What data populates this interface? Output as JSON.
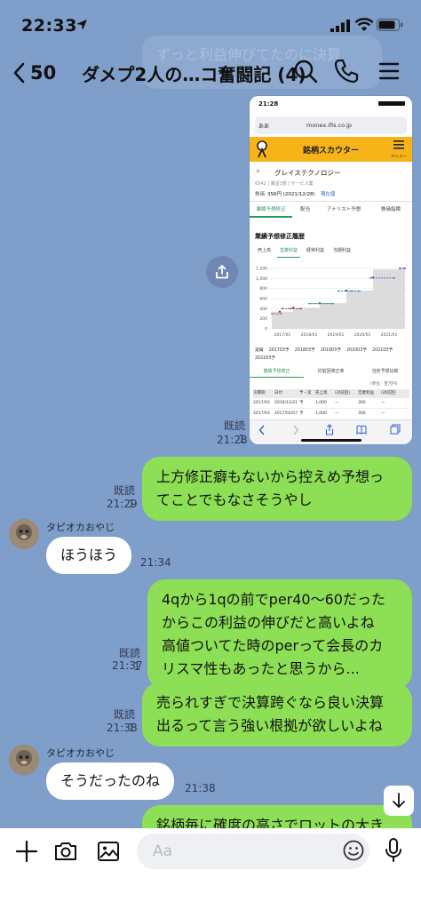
{
  "status": {
    "time": "22:33"
  },
  "header": {
    "back_count": "50",
    "title": "ダメプ2人の…コ奮闘記 (4)"
  },
  "background_message": {
    "text": "ずっと利益伸びてたのに決算"
  },
  "screenshot": {
    "status_time": "21:28",
    "url_prefix": "ああ",
    "url": "monex.ifis.co.jp",
    "site_name": "銘柄スカウター",
    "menu_label": "メニュー",
    "company": "グレイステクノロジー",
    "company_meta": "6541 | 東証1部 | サービス業",
    "price_label": "株価",
    "price": "356円 (2021/12/28)",
    "now_link": "現在値",
    "tabs": [
      "業績予想修正",
      "配当",
      "アナリスト予想",
      "株価指標"
    ],
    "section_title": "業績予想修正履歴",
    "subtabs": [
      "売上高",
      "営業利益",
      "経常利益",
      "当期利益"
    ],
    "chart_yticks": [
      "1,200",
      "1,000",
      "800",
      "600",
      "400",
      "200",
      "0"
    ],
    "chart_xticks": [
      "2017/01",
      "2018/01",
      "2019/01",
      "2020/01",
      "2021/01"
    ],
    "legend": [
      "実績",
      "201703予",
      "201803予",
      "201903予",
      "202003予",
      "202103予",
      "202203予"
    ],
    "bottom_tabs": [
      "業績予想修正",
      "対前回修正率",
      "当初予想比較"
    ],
    "unit": "(単位：百万円)",
    "table_headers": [
      "決算期",
      "日付",
      "予・実",
      "売上高",
      "(対前回)",
      "営業利益",
      "(対前回)"
    ],
    "table_rows": [
      [
        "2017/03",
        "2016/12/21",
        "予",
        "1,000",
        "—",
        "300",
        "—"
      ],
      [
        "2017/03",
        "2017/02/07",
        "予",
        "1,000",
        "—",
        "300",
        "—"
      ]
    ]
  },
  "chart_data": {
    "type": "line",
    "title": "業績予想修正履歴",
    "xlabel": "",
    "ylabel": "",
    "ylim": [
      0,
      1200
    ],
    "x_ticks": [
      "2017/01",
      "2018/01",
      "2019/01",
      "2020/01",
      "2021/01"
    ],
    "series": [
      {
        "name": "実績",
        "values": [
          [
            2016.9,
            340
          ],
          [
            2017.4,
            420
          ],
          [
            2018.4,
            510
          ],
          [
            2019.4,
            760
          ],
          [
            2020.4,
            1020
          ]
        ]
      },
      {
        "name": "201703予",
        "values": [
          [
            2016.6,
            300
          ],
          [
            2016.95,
            300
          ]
        ]
      },
      {
        "name": "201803予",
        "values": [
          [
            2017.0,
            400
          ],
          [
            2017.3,
            400
          ],
          [
            2017.7,
            400
          ]
        ]
      },
      {
        "name": "201903予",
        "values": [
          [
            2018.0,
            500
          ],
          [
            2018.4,
            500
          ],
          [
            2018.9,
            500
          ]
        ]
      },
      {
        "name": "202003予",
        "values": [
          [
            2019.1,
            750
          ],
          [
            2019.6,
            750
          ],
          [
            2019.9,
            750
          ]
        ]
      },
      {
        "name": "202103予",
        "values": [
          [
            2020.3,
            1010
          ],
          [
            2021.2,
            1010
          ]
        ]
      },
      {
        "name": "202203予",
        "values": [
          [
            2021.4,
            1200
          ],
          [
            2021.6,
            1200
          ]
        ]
      }
    ],
    "bar_values": [
      {
        "x_start": 2016.6,
        "x_end": 2017.4,
        "value": 340
      },
      {
        "x_start": 2017.4,
        "x_end": 2018.4,
        "value": 420
      },
      {
        "x_start": 2018.4,
        "x_end": 2019.4,
        "value": 510
      },
      {
        "x_start": 2019.4,
        "x_end": 2020.4,
        "value": 760
      },
      {
        "x_start": 2020.4,
        "x_end": 2021.6,
        "value": 1180
      }
    ]
  },
  "messages": [
    {
      "read": "既読 1",
      "time": "21:28"
    },
    {
      "read": "既読 1",
      "time": "21:29",
      "lines": [
        "上方修正癖もないから控えめ予想っ",
        "てことでもなさそうやし"
      ]
    },
    {
      "sender": "タピオカおやじ",
      "time": "21:34",
      "lines": [
        "ほうほう"
      ]
    },
    {
      "read": "既読 1",
      "time": "21:37",
      "lines": [
        "4qから1qの前でper40〜60だった",
        "からこの利益の伸びだと高いよね",
        "高値ついてた時のperって会長のカ",
        "リスマ性もあったと思うから..."
      ]
    },
    {
      "read": "既読 1",
      "time": "21:38",
      "lines": [
        "売られすぎで決算跨ぐなら良い決算",
        "出るって言う強い根拠が欲しいよね"
      ]
    },
    {
      "sender": "タピオカおやじ",
      "time": "21:38",
      "lines": [
        "そうだったのね"
      ]
    },
    {
      "lines": [
        "銘柄毎に確度の高さでロットの大き"
      ]
    }
  ],
  "input": {
    "placeholder": "Aa"
  }
}
